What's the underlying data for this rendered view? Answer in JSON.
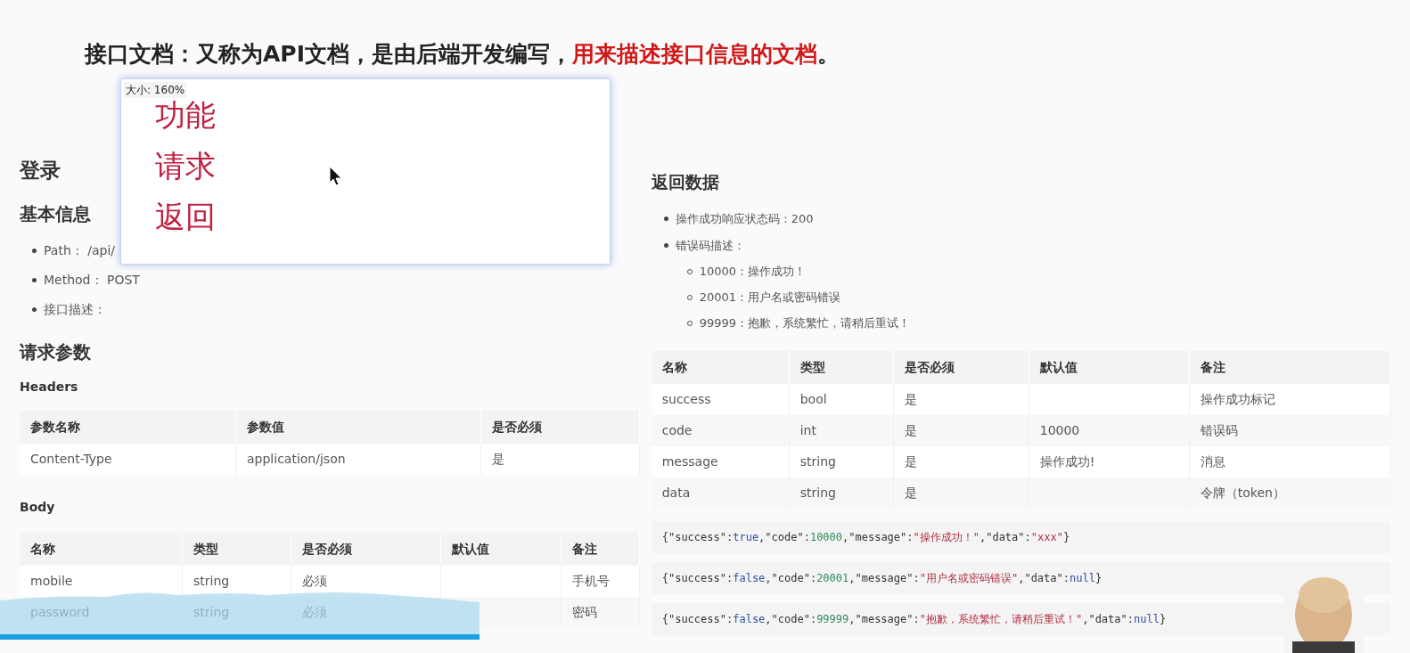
{
  "title": [
    {
      "text": "接口文档：又称为API文档，是由后端开发编写，",
      "kind": "plain"
    },
    {
      "text": "用来描述接口信息的文档",
      "kind": "highlight"
    },
    {
      "text": "。",
      "kind": "plain"
    }
  ],
  "popup": {
    "zoom_label": "大小: 160%",
    "lines": [
      "功能",
      "请求",
      "返回"
    ]
  },
  "left": {
    "heading": "登录",
    "basic_heading": "基本信息",
    "basic_items": [
      "Path： /api/",
      "Method： POST",
      "接口描述："
    ],
    "params_heading": "请求参数",
    "headers_label": "Headers",
    "headers_table": {
      "columns": [
        "参数名称",
        "参数值",
        "是否必须"
      ],
      "rows": [
        [
          "Content-Type",
          "application/json",
          "是"
        ]
      ]
    },
    "body_label": "Body",
    "body_table": {
      "columns": [
        "名称",
        "类型",
        "是否必须",
        "默认值",
        "备注"
      ],
      "rows": [
        [
          "mobile",
          "string",
          "必须",
          null,
          "手机号"
        ],
        [
          "password",
          "string",
          "必须",
          null,
          "密码"
        ]
      ]
    }
  },
  "right": {
    "heading": "返回数据",
    "items": [
      {
        "text": "操作成功响应状态码：200"
      },
      {
        "text": "错误码描述：",
        "children": [
          "10000：操作成功！",
          "20001：用户名或密码错误",
          "99999：抱歉，系统繁忙，请稍后重试！"
        ]
      }
    ],
    "table": {
      "columns": [
        "名称",
        "类型",
        "是否必须",
        "默认值",
        "备注"
      ],
      "rows": [
        [
          "success",
          "bool",
          "是",
          null,
          "操作成功标记"
        ],
        [
          "code",
          "int",
          "是",
          "10000",
          "错误码"
        ],
        [
          "message",
          "string",
          "是",
          "操作成功!",
          "消息"
        ],
        [
          "data",
          "string",
          "是",
          null,
          "令牌（token）"
        ]
      ]
    },
    "code_blocks": [
      [
        {
          "t": "{\"success\":",
          "kind": "plain"
        },
        {
          "t": "true",
          "kind": "bool"
        },
        {
          "t": ",\"code\":",
          "kind": "plain"
        },
        {
          "t": "10000",
          "kind": "number"
        },
        {
          "t": ",\"message\":",
          "kind": "plain"
        },
        {
          "t": "\"操作成功！\"",
          "kind": "string"
        },
        {
          "t": ",\"data\":",
          "kind": "plain"
        },
        {
          "t": "\"xxx\"",
          "kind": "string"
        },
        {
          "t": "}",
          "kind": "plain"
        }
      ],
      [
        {
          "t": "{\"success\":",
          "kind": "plain"
        },
        {
          "t": "false",
          "kind": "bool"
        },
        {
          "t": ",\"code\":",
          "kind": "plain"
        },
        {
          "t": "20001",
          "kind": "number"
        },
        {
          "t": ",\"message\":",
          "kind": "plain"
        },
        {
          "t": "\"用户名或密码错误\"",
          "kind": "string"
        },
        {
          "t": ",\"data\":",
          "kind": "plain"
        },
        {
          "t": "null",
          "kind": "bool"
        },
        {
          "t": "}",
          "kind": "plain"
        }
      ],
      [
        {
          "t": "{\"success\":",
          "kind": "plain"
        },
        {
          "t": "false",
          "kind": "bool"
        },
        {
          "t": ",\"code\":",
          "kind": "plain"
        },
        {
          "t": "99999",
          "kind": "number"
        },
        {
          "t": ",\"message\":",
          "kind": "plain"
        },
        {
          "t": "\"抱歉，系统繁忙，请稍后重试！\"",
          "kind": "string"
        },
        {
          "t": ",\"data\":",
          "kind": "plain"
        },
        {
          "t": "null",
          "kind": "bool"
        },
        {
          "t": "}",
          "kind": "plain"
        }
      ]
    ]
  },
  "video_progress": {
    "level": 0.34
  }
}
